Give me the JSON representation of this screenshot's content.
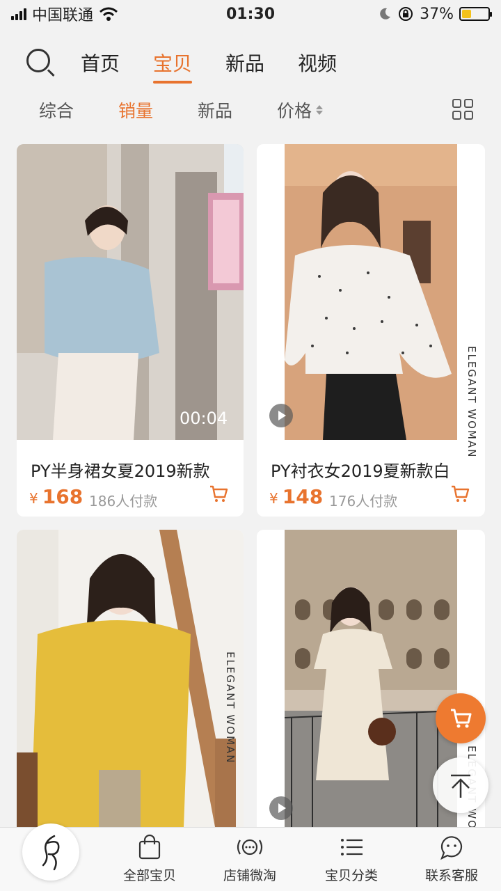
{
  "status_bar": {
    "carrier": "中国联通",
    "time": "01:30",
    "battery": "37%",
    "battery_level": 0.37,
    "icons": [
      "signal-icon",
      "wifi-icon",
      "moon-icon",
      "rotation-lock-icon",
      "battery-icon"
    ]
  },
  "top_nav": {
    "search_icon": "search-icon",
    "tabs": [
      {
        "label": "首页",
        "active": false
      },
      {
        "label": "宝贝",
        "active": true
      },
      {
        "label": "新品",
        "active": false
      },
      {
        "label": "视频",
        "active": false
      }
    ]
  },
  "sort_bar": {
    "options": [
      {
        "label": "综合",
        "active": false
      },
      {
        "label": "销量",
        "active": true
      },
      {
        "label": "新品",
        "active": false
      },
      {
        "label": "价格",
        "active": false
      }
    ],
    "layout_toggle_icon": "grid-view-icon"
  },
  "products": [
    {
      "title": "PY半身裙女夏2019新款",
      "currency": "¥",
      "price": "168",
      "paid": "186人付款",
      "video_duration": "00:04"
    },
    {
      "title": "PY衬衣女2019夏新款白",
      "currency": "¥",
      "price": "148",
      "paid": "176人付款",
      "brand_text": "ELEGANT WOMAN"
    },
    {
      "brand_text": "ELEGANT WOMAN"
    },
    {
      "brand_text": "ELEGANT WOMAN"
    }
  ],
  "floating": {
    "cart_icon": "cart-icon",
    "back_to_top_icon": "arrow-up-icon"
  },
  "bottom_bar": {
    "items": [
      {
        "label": "全部宝贝",
        "icon": "shopping-bag-icon"
      },
      {
        "label": "店铺微淘",
        "icon": "broadcast-icon"
      },
      {
        "label": "宝贝分类",
        "icon": "list-icon"
      },
      {
        "label": "联系客服",
        "icon": "chat-face-icon"
      }
    ]
  },
  "colors": {
    "accent": "#e8732e",
    "background": "#f2f2f2"
  }
}
